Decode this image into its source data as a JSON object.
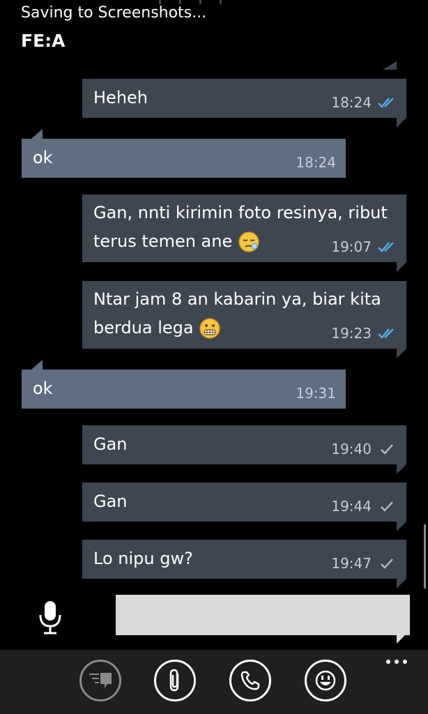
{
  "status": {
    "saving_text": "Saving to Screenshots..."
  },
  "header": {
    "contact_name": "FE:A"
  },
  "messages": [
    {
      "direction": "out",
      "text": "Heheh",
      "time": "18:24",
      "status": "read"
    },
    {
      "direction": "in",
      "text": "ok",
      "time": "18:24"
    },
    {
      "direction": "out",
      "text": "Gan, nnti kirimin foto resinya, ribut\nterus temen ane",
      "emoji": "sleepy-face",
      "time": "19:07",
      "status": "read"
    },
    {
      "direction": "out",
      "text": "Ntar jam 8 an kabarin ya, biar kita\nberdua lega",
      "emoji": "grimacing-face",
      "time": "19:23",
      "status": "read"
    },
    {
      "direction": "in",
      "text": "ok",
      "time": "19:31"
    },
    {
      "direction": "out",
      "text": "Gan",
      "time": "19:40",
      "status": "sent"
    },
    {
      "direction": "out",
      "text": "Gan",
      "time": "19:44",
      "status": "sent"
    },
    {
      "direction": "out",
      "text": "Lo nipu gw?",
      "time": "19:47",
      "status": "sent"
    }
  ],
  "composer": {
    "value": "",
    "placeholder": ""
  },
  "appbar": {
    "buttons": [
      "chat-bubbles-icon",
      "attach-icon",
      "phone-icon",
      "emoji-icon"
    ],
    "more": "more-icon"
  },
  "colors": {
    "outgoing_bubble": "#3d4651",
    "incoming_bubble": "#5f6f81",
    "read_tick": "#4fb3f0",
    "sent_tick": "#b9bec4"
  }
}
